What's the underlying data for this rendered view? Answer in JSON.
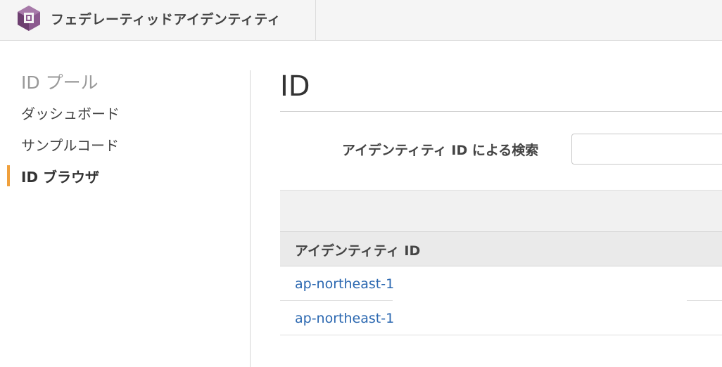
{
  "header": {
    "service_title": "フェデレーティッドアイデンティティ",
    "logo_icon": "cognito-logo-icon"
  },
  "sidebar": {
    "heading": "ID プール",
    "items": [
      {
        "label": "ダッシュボード",
        "active": false
      },
      {
        "label": "サンプルコード",
        "active": false
      },
      {
        "label": "ID ブラウザ",
        "active": true
      }
    ],
    "active_color": "#f0a03c"
  },
  "main": {
    "title": "ID",
    "search": {
      "label": "アイデンティティ ID による検索",
      "value": "",
      "placeholder": ""
    },
    "table": {
      "columns": [
        "アイデンティティ ID"
      ],
      "rows": [
        {
          "identity_id": "ap-northeast-1"
        },
        {
          "identity_id": "ap-northeast-1"
        }
      ]
    }
  },
  "colors": {
    "link": "#2a67b0",
    "logo": "#7b4a7e"
  }
}
